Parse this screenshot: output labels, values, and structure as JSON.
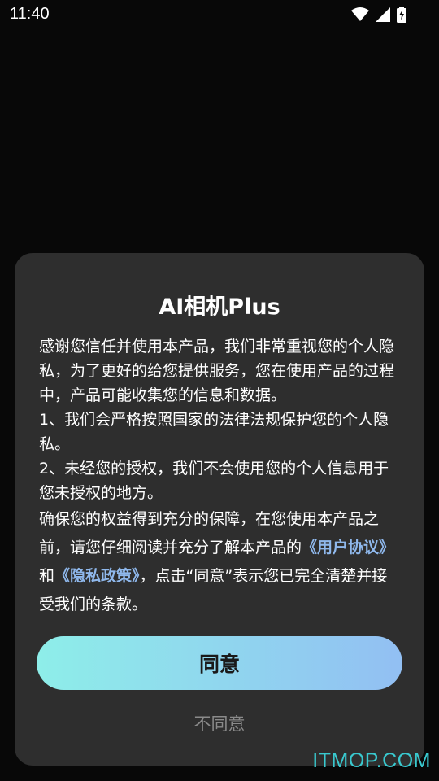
{
  "status_bar": {
    "time": "11:40",
    "icons": [
      "wifi-icon",
      "signal-icon",
      "battery-charging-icon"
    ]
  },
  "dialog": {
    "title": "AI相机Plus",
    "body_lines_1": "感谢您信任并使用本产品，我们非常重视您的个人隐私，为了更好的给您提供服务，您在使用产品的过程中，产品可能收集您的信息和数据。",
    "item_1": "1、我们会严格按照国家的法律法规保护您的个人隐私。",
    "item_2": "2、未经您的授权，我们不会使用您的个人信息用于您未授权的地方。",
    "para2_start": "确保您的权益得到充分的保障，在您使用本产品之前，请您仔细阅读并充分了解本产品的",
    "user_agreement_link": "《用户协议》",
    "and_text": "和",
    "privacy_policy_link": "《隐私政策》",
    "para2_end": "，点击“同意”表示您已完全清楚并接受我们的条款。",
    "agree_label": "同意",
    "decline_label": "不同意"
  },
  "watermark": "ITMOP.COM",
  "colors": {
    "background": "#080808",
    "dialog": "#2e2e2e",
    "link": "#8fb8ec",
    "button_gradient_start": "#8eeee9",
    "button_gradient_end": "#92bff3",
    "watermark": "#39c9cf"
  }
}
